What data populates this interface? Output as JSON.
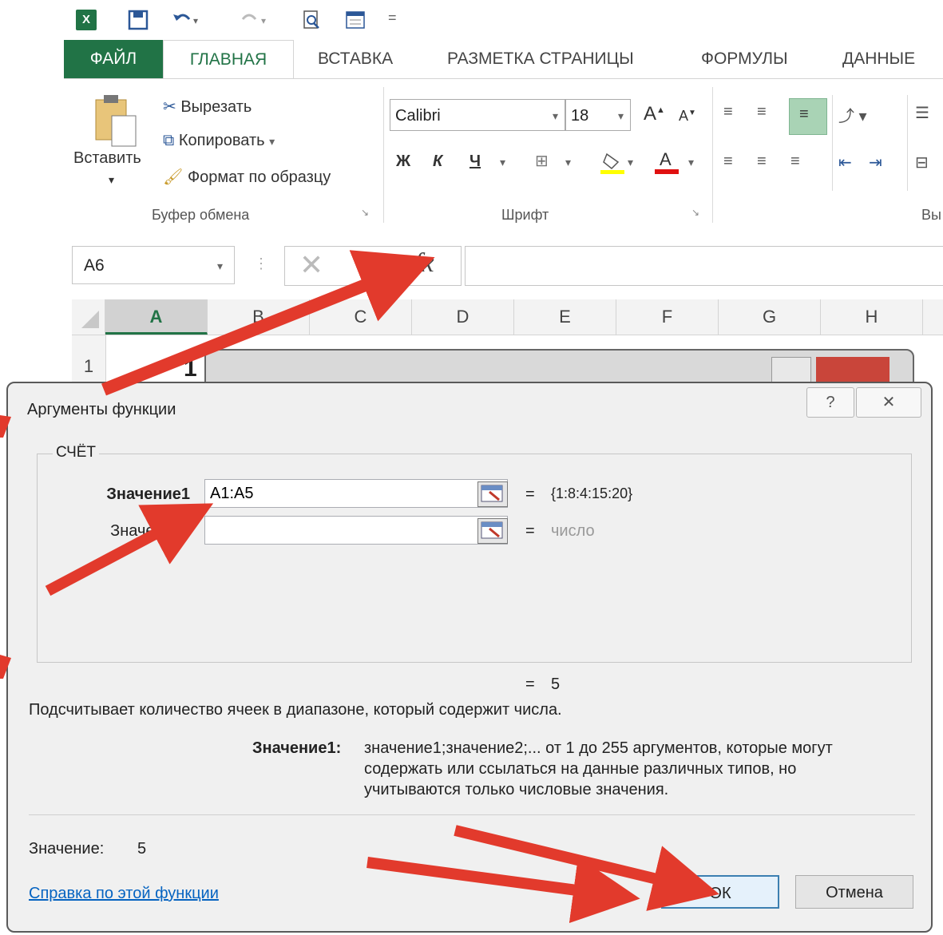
{
  "ribbon_tabs": [
    "ФАЙЛ",
    "ГЛАВНАЯ",
    "ВСТАВКА",
    "РАЗМЕТКА СТРАНИЦЫ",
    "ФОРМУЛЫ",
    "ДАННЫЕ"
  ],
  "clipboard": {
    "paste": "Вставить",
    "cut": "Вырезать",
    "copy": "Копировать",
    "format_painter": "Формат по образцу",
    "group_label": "Буфер обмена"
  },
  "font": {
    "name": "Calibri",
    "size": "18",
    "bold": "Ж",
    "italic": "К",
    "underline": "Ч",
    "group_label": "Шрифт"
  },
  "alignment_group_label_partial": "Вы",
  "formula_bar": {
    "name_box": "A6",
    "fx": "fx"
  },
  "columns": [
    "A",
    "B",
    "C",
    "D",
    "E",
    "F",
    "G",
    "H"
  ],
  "row_numbers": [
    "1"
  ],
  "cell_a1": "1",
  "dialog": {
    "title": "Аргументы функции",
    "function_name": "СЧЁТ",
    "arg1_label": "Значение1",
    "arg1_value": "A1:A5",
    "arg1_result": "{1:8:4:15:20}",
    "arg2_label": "Значение2",
    "arg2_value": "",
    "arg2_result": "число",
    "equals": "=",
    "formula_result": "5",
    "description": "Подсчитывает количество ячеек в диапазоне, который содержит числа.",
    "arg_help_label": "Значение1:",
    "arg_help_text_1": "значение1;значение2;... от 1 до 255 аргументов, которые могут",
    "arg_help_text_2": "содержать или ссылаться на данные различных типов, но",
    "arg_help_text_3": "учитываются только числовые значения.",
    "value_label": "Значение:",
    "value": "5",
    "help_link": "Справка по этой функции",
    "ok": "ОК",
    "cancel": "Отмена",
    "help_button": "?",
    "close_button": "✕"
  },
  "colors": {
    "excel_green": "#217346",
    "arrow_red": "#e23a2c"
  }
}
